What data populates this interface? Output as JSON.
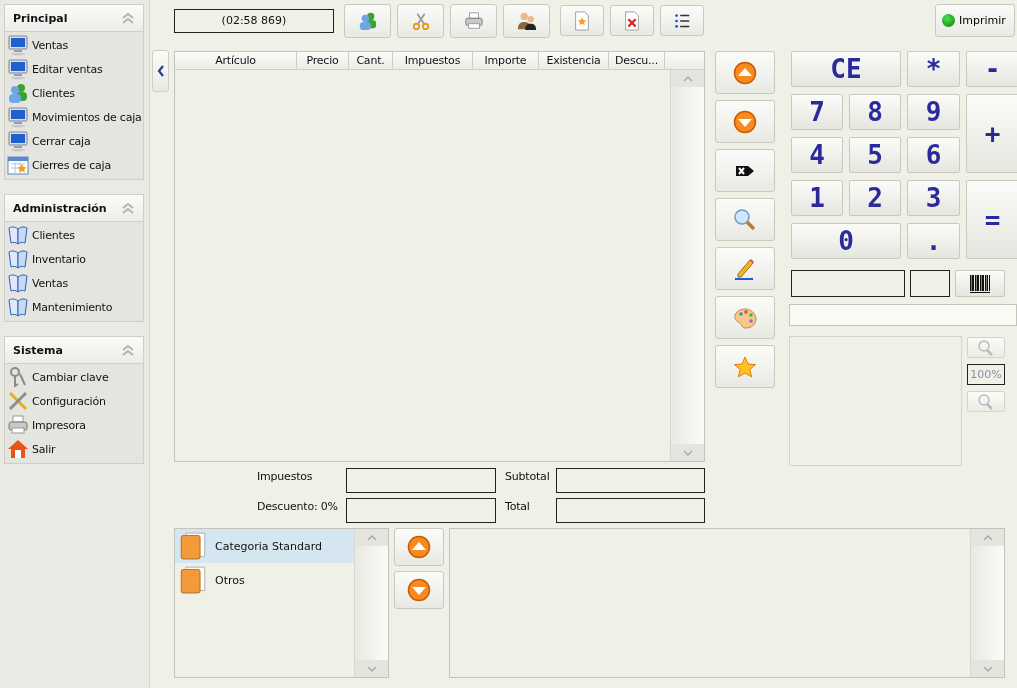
{
  "sidebar": {
    "sections": [
      {
        "title": "Principal",
        "expanded": true,
        "items": [
          {
            "label": "Ventas",
            "kind": "monitor"
          },
          {
            "label": "Editar ventas",
            "kind": "monitor"
          },
          {
            "label": "Clientes",
            "kind": "users"
          },
          {
            "label": "Movimientos de caja",
            "kind": "monitor"
          },
          {
            "label": "Cerrar caja",
            "kind": "monitor"
          },
          {
            "label": "Cierres de caja",
            "kind": "calendar"
          }
        ]
      },
      {
        "title": "Administración",
        "expanded": true,
        "items": [
          {
            "label": "Clientes",
            "kind": "book"
          },
          {
            "label": "Inventario",
            "kind": "book"
          },
          {
            "label": "Ventas",
            "kind": "book"
          },
          {
            "label": "Mantenimiento",
            "kind": "book"
          }
        ]
      },
      {
        "title": "Sistema",
        "expanded": true,
        "items": [
          {
            "label": "Cambiar clave",
            "kind": "keys"
          },
          {
            "label": "Configuración",
            "kind": "tools"
          },
          {
            "label": "Impresora",
            "kind": "printer"
          },
          {
            "label": "Salir",
            "kind": "house"
          }
        ]
      }
    ]
  },
  "toolbar": {
    "timer": "(02:58 869)",
    "buttons": [
      {
        "kind": "users"
      },
      {
        "kind": "scissors"
      },
      {
        "kind": "printer"
      },
      {
        "kind": "couple"
      },
      {
        "kind": "doc-star"
      },
      {
        "kind": "doc-x"
      },
      {
        "kind": "list"
      }
    ],
    "print_button": {
      "label": "Imprimir"
    }
  },
  "table": {
    "columns": [
      "Artículo",
      "Precio",
      "Cant.",
      "Impuestos",
      "Importe",
      "Existencia",
      "Descu..."
    ]
  },
  "side_buttons": [
    {
      "kind": "up"
    },
    {
      "kind": "down"
    },
    {
      "kind": "tag-x"
    },
    {
      "kind": "search"
    },
    {
      "kind": "pencil"
    },
    {
      "kind": "palette"
    },
    {
      "kind": "star"
    }
  ],
  "keypad": [
    "CE",
    "*",
    "-",
    "7",
    "8",
    "9",
    "+",
    "4",
    "5",
    "6",
    "1",
    "2",
    "3",
    "=",
    "0",
    "."
  ],
  "totals": [
    {
      "label": "Impuestos"
    },
    {
      "label": "Subtotal"
    },
    {
      "label": "Descuento: 0%"
    },
    {
      "label": "Total"
    }
  ],
  "zoom": {
    "level": "100%"
  },
  "categories": [
    {
      "label": "Categoria Standard",
      "selected": true
    },
    {
      "label": "Otros",
      "selected": false
    }
  ]
}
